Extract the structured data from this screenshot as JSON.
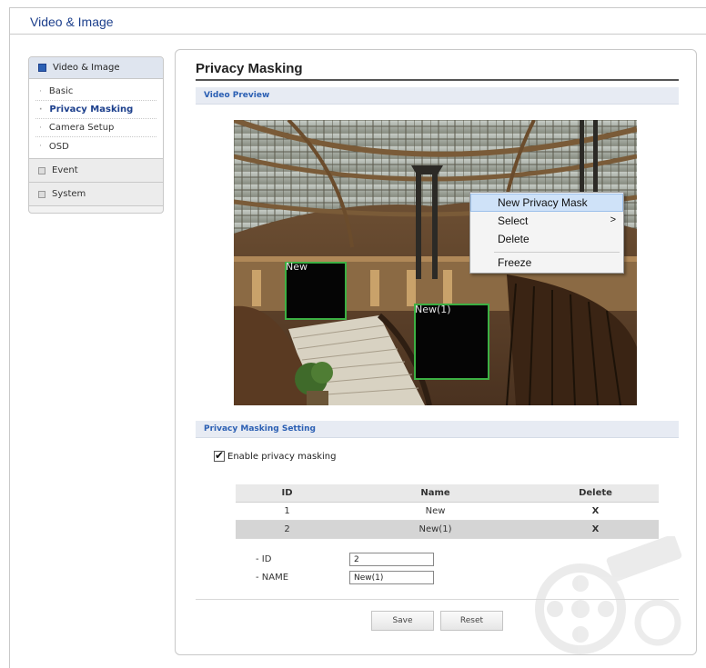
{
  "header": {
    "title": "Video & Image"
  },
  "sidebar": {
    "section_title": "Video & Image",
    "items": [
      {
        "label": "Basic",
        "active": false
      },
      {
        "label": "Privacy Masking",
        "active": true
      },
      {
        "label": "Camera Setup",
        "active": false
      },
      {
        "label": "OSD",
        "active": false
      }
    ],
    "groups": [
      {
        "label": "Event"
      },
      {
        "label": "System"
      }
    ]
  },
  "main": {
    "title": "Privacy Masking",
    "video_section": "Video Preview",
    "masks": [
      {
        "label": "New"
      },
      {
        "label": "New(1)"
      }
    ],
    "context_menu": {
      "items": [
        "New Privacy Mask",
        "Select",
        "Delete",
        "Freeze"
      ],
      "highlighted": "New Privacy Mask",
      "submenu_arrow": ">"
    },
    "settings_section": "Privacy Masking Setting",
    "enable_label": "Enable privacy masking",
    "enable_checked": true,
    "table": {
      "headers": [
        "ID",
        "Name",
        "Delete"
      ],
      "rows": [
        {
          "id": "1",
          "name": "New",
          "delete": "X"
        },
        {
          "id": "2",
          "name": "New(1)",
          "delete": "X"
        }
      ],
      "selected_row": 2
    },
    "fields": {
      "id_label": "- ID",
      "id_value": "2",
      "name_label": "- NAME",
      "name_value": "New(1)"
    },
    "buttons": {
      "save": "Save",
      "reset": "Reset"
    }
  },
  "colors": {
    "accent": "#1c3f8c",
    "section_bar": "#e7ebf3",
    "mask_border": "#3cb043",
    "menu_highlight": "#cfe2f8"
  }
}
